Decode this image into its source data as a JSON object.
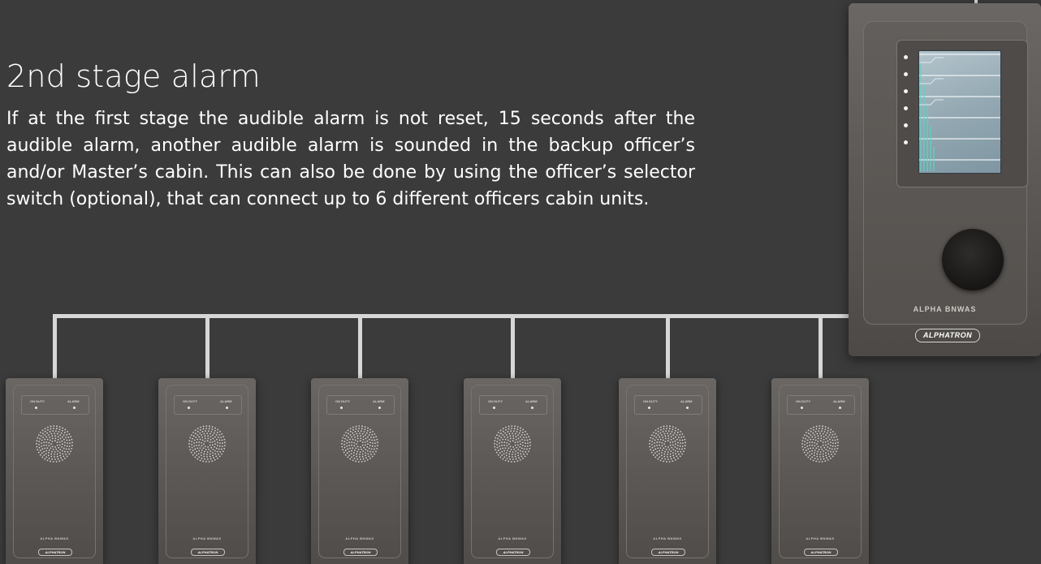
{
  "heading": "2nd stage alarm",
  "description": "If at the first stage the audible alarm is not reset, 15 seconds after the audible alarm, another audible alarm is sounded in the backup officer’s and/or Master’s cabin. This can also be done by using the officer’s selector switch (optional), that can connect up to 6 different officers cabin units.",
  "master_unit": {
    "brand_label": "ALPHA BNWAS",
    "logo_text": "ALPHATRON",
    "led_count": 6
  },
  "cabin_units": [
    {
      "left_label": "ON DUTY",
      "right_label": "ALARM",
      "brand_label": "ALPHA BNWAS",
      "logo_text": "ALPHATRON"
    },
    {
      "left_label": "ON DUTY",
      "right_label": "ALARM",
      "brand_label": "ALPHA BNWAS",
      "logo_text": "ALPHATRON"
    },
    {
      "left_label": "ON DUTY",
      "right_label": "ALARM",
      "brand_label": "ALPHA BNWAS",
      "logo_text": "ALPHATRON"
    },
    {
      "left_label": "ON DUTY",
      "right_label": "ALARM",
      "brand_label": "ALPHA BNWAS",
      "logo_text": "ALPHATRON"
    },
    {
      "left_label": "ON DUTY",
      "right_label": "ALARM",
      "brand_label": "ALPHA BNWAS",
      "logo_text": "ALPHATRON"
    },
    {
      "left_label": "ON DUTY",
      "right_label": "ALARM",
      "brand_label": "ALPHA BNWAS",
      "logo_text": "ALPHATRON"
    }
  ],
  "colors": {
    "background": "#3b3b3b",
    "wire": "#d7d7d7",
    "text": "#ffffff"
  }
}
